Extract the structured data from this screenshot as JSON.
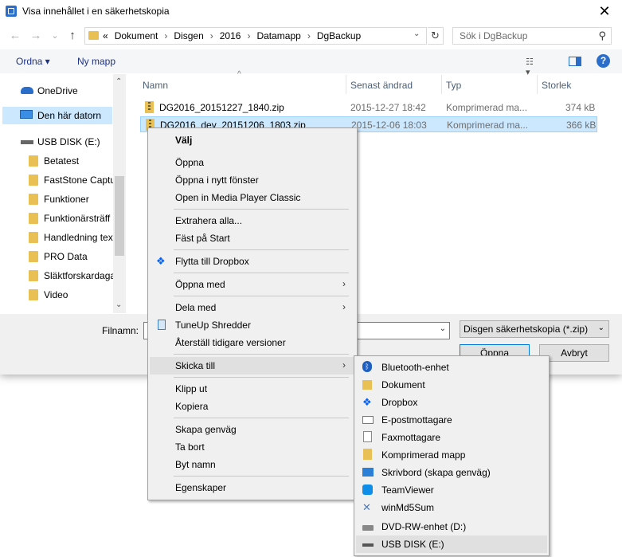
{
  "window": {
    "title": "Visa innehållet i en säkerhetskopia",
    "close_glyph": "✕"
  },
  "nav": {
    "back_glyph": "←",
    "forward_glyph": "→",
    "recent_glyph": "⌄",
    "up_glyph": "↑",
    "breadcrumb_prefix": "«",
    "breadcrumbs": [
      "Dokument",
      "Disgen",
      "2016",
      "Datamapp",
      "DgBackup"
    ],
    "crumb_separator": "›",
    "dropdown_glyph": "⌄",
    "refresh_glyph": "↻",
    "search_placeholder": "Sök i DgBackup",
    "search_glyph": "⚲"
  },
  "toolbar": {
    "organize": "Ordna ▾",
    "new_folder": "Ny mapp",
    "view_glyph": "☷ ▾",
    "help": "?"
  },
  "sidebar": {
    "items": [
      {
        "label": "OneDrive",
        "icon": "cloud-icon"
      },
      {
        "label": "Den här datorn",
        "icon": "computer-icon"
      },
      {
        "label": "USB DISK (E:)",
        "icon": "usb-drive-icon"
      },
      {
        "label": "Betatest",
        "icon": "folder-icon"
      },
      {
        "label": "FastStone Captu",
        "icon": "folder-icon"
      },
      {
        "label": "Funktioner",
        "icon": "folder-icon"
      },
      {
        "label": "Funktionärsträff",
        "icon": "folder-icon"
      },
      {
        "label": "Handledning tex",
        "icon": "folder-icon"
      },
      {
        "label": "PRO Data",
        "icon": "folder-icon"
      },
      {
        "label": "Släktforskardaga",
        "icon": "folder-icon"
      },
      {
        "label": "Video",
        "icon": "folder-icon"
      }
    ],
    "scroll_up": "⌃",
    "scroll_down": "⌄"
  },
  "file_list": {
    "sort_glyph": "^",
    "columns": [
      "Namn",
      "Senast ändrad",
      "Typ",
      "Storlek"
    ],
    "rows": [
      {
        "name": "DG2016_20151227_1840.zip",
        "modified": "2015-12-27 18:42",
        "type": "Komprimerad ma...",
        "size": "374 kB"
      },
      {
        "name": "DG2016_dev_20151206_1803.zip",
        "modified": "2015-12-06 18:03",
        "type": "Komprimerad ma...",
        "size": "366 kB"
      }
    ]
  },
  "bottom": {
    "filename_label": "Filnamn:",
    "filter_value": "Disgen säkerhetskopia (*.zip)",
    "open_label": "Öppna",
    "cancel_label": "Avbryt",
    "dd_glyph": "⌄"
  },
  "context_menu": {
    "items": [
      {
        "label": "Välj",
        "bold": true
      },
      {
        "label": "Öppna"
      },
      {
        "label": "Öppna i nytt fönster"
      },
      {
        "label": "Open in Media Player Classic"
      },
      {
        "label": "Extrahera alla..."
      },
      {
        "label": "Fäst på Start"
      },
      {
        "label": "Flytta till Dropbox",
        "icon": "dropbox-icon"
      },
      {
        "label": "Öppna med",
        "submenu": true
      },
      {
        "label": "Dela med",
        "submenu": true
      },
      {
        "label": "TuneUp Shredder",
        "icon": "shredder-icon"
      },
      {
        "label": "Återställ tidigare versioner"
      },
      {
        "label": "Skicka till",
        "submenu": true
      },
      {
        "label": "Klipp ut"
      },
      {
        "label": "Kopiera"
      },
      {
        "label": "Skapa genväg"
      },
      {
        "label": "Ta bort"
      },
      {
        "label": "Byt namn"
      },
      {
        "label": "Egenskaper"
      }
    ],
    "arrow_glyph": "›"
  },
  "send_to_menu": {
    "items": [
      {
        "label": "Bluetooth-enhet",
        "icon": "bluetooth-icon"
      },
      {
        "label": "Dokument",
        "icon": "documents-icon"
      },
      {
        "label": "Dropbox",
        "icon": "dropbox-icon"
      },
      {
        "label": "E-postmottagare",
        "icon": "mail-icon"
      },
      {
        "label": "Faxmottagare",
        "icon": "fax-icon"
      },
      {
        "label": "Komprimerad mapp",
        "icon": "zip-folder-icon"
      },
      {
        "label": "Skrivbord (skapa genväg)",
        "icon": "desktop-icon"
      },
      {
        "label": "TeamViewer",
        "icon": "teamviewer-icon"
      },
      {
        "label": "winMd5Sum",
        "icon": "winmd5sum-icon"
      },
      {
        "label": "DVD-RW-enhet (D:)",
        "icon": "dvd-drive-icon"
      },
      {
        "label": "USB DISK (E:)",
        "icon": "usb-drive-icon"
      }
    ]
  },
  "colors": {
    "selection": "#cce8ff",
    "link": "#1e3287",
    "accent": "#0078d7"
  }
}
